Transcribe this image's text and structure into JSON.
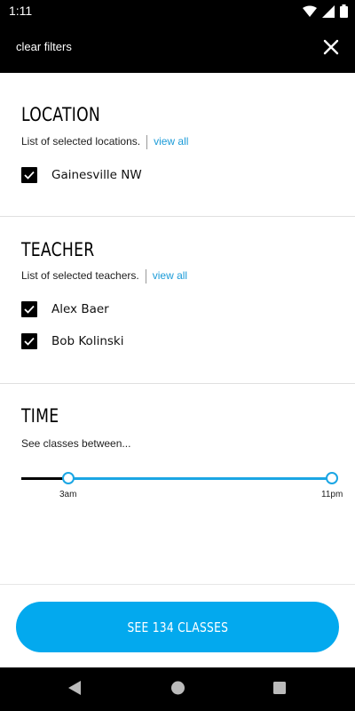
{
  "status_bar": {
    "time": "1:11"
  },
  "top_bar": {
    "clear_filters": "clear filters"
  },
  "location": {
    "title": "LOCATION",
    "subtitle": "List of selected locations.",
    "view_all": "view all",
    "items": [
      {
        "label": "Gainesville NW",
        "checked": true
      }
    ]
  },
  "teacher": {
    "title": "TEACHER",
    "subtitle": "List of selected teachers.",
    "view_all": "view all",
    "items": [
      {
        "label": "Alex Baer",
        "checked": true
      },
      {
        "label": "Bob Kolinski",
        "checked": true
      }
    ]
  },
  "time": {
    "title": "TIME",
    "subtitle": "See classes between...",
    "start_label": "3am",
    "end_label": "11pm"
  },
  "footer": {
    "see_button": "SEE 134 CLASSES"
  },
  "colors": {
    "accent": "#03a9ee",
    "link": "#1b9bd8",
    "slider": "#1ba6e4"
  }
}
